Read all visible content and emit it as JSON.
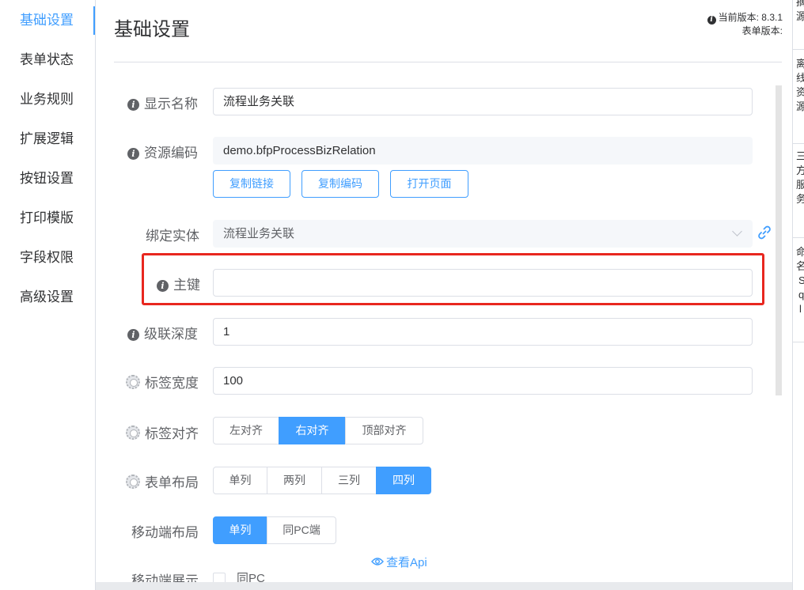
{
  "sidebar": {
    "items": [
      {
        "label": "基础设置",
        "active": true
      },
      {
        "label": "表单状态"
      },
      {
        "label": "业务规则"
      },
      {
        "label": "扩展逻辑"
      },
      {
        "label": "按钮设置"
      },
      {
        "label": "打印模版"
      },
      {
        "label": "字段权限"
      },
      {
        "label": "高级设置"
      }
    ]
  },
  "header": {
    "title": "基础设置",
    "current_version": "当前版本: 8.3.1",
    "form_version": "表单版本:"
  },
  "form": {
    "display_name": {
      "label": "显示名称",
      "value": "流程业务关联"
    },
    "resource_code": {
      "label": "资源编码",
      "value": "demo.bfpProcessBizRelation"
    },
    "buttons": {
      "copy_link": "复制链接",
      "copy_code": "复制编码",
      "open_page": "打开页面"
    },
    "bound_entity": {
      "label": "绑定实体",
      "value": "流程业务关联"
    },
    "primary_key": {
      "label": "主键",
      "value": ""
    },
    "cascade_depth": {
      "label": "级联深度",
      "value": "1"
    },
    "label_width": {
      "label": "标签宽度",
      "value": "100"
    },
    "label_align": {
      "label": "标签对齐",
      "options": [
        "左对齐",
        "右对齐",
        "顶部对齐"
      ],
      "selected": "右对齐"
    },
    "form_layout": {
      "label": "表单布局",
      "options": [
        "单列",
        "两列",
        "三列",
        "四列"
      ],
      "selected": "四列"
    },
    "mobile_layout": {
      "label": "移动端布局",
      "options": [
        "单列",
        "同PC端"
      ],
      "selected": "单列"
    },
    "mobile_display": {
      "label": "移动端展示",
      "checkbox_label": "同PC"
    },
    "view_api": "查看Api"
  },
  "right_panel": {
    "blocks": [
      [
        "摘",
        "源"
      ],
      [
        "离",
        "线",
        "资",
        "源"
      ],
      [
        "三",
        "方",
        "服",
        "务"
      ],
      [
        "命",
        "名",
        "S",
        "q",
        "l"
      ]
    ]
  },
  "colors": {
    "accent": "#409eff",
    "highlight": "#e8271f"
  }
}
